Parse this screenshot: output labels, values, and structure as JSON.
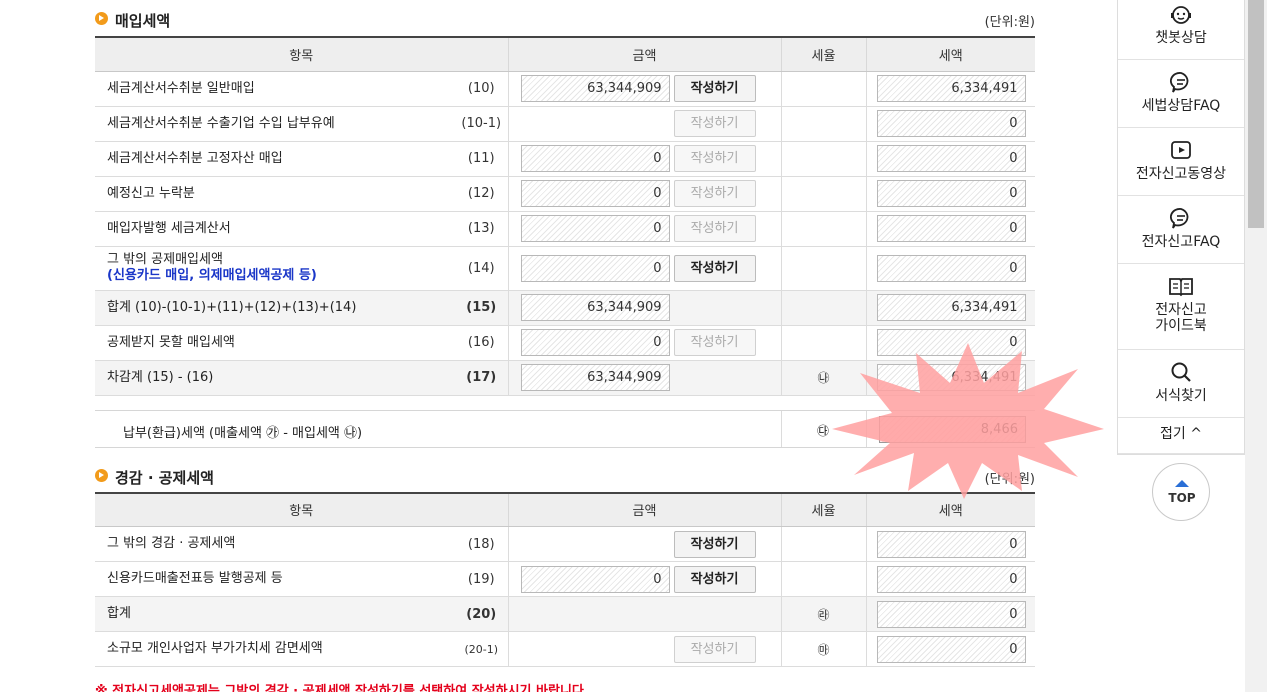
{
  "purchase": {
    "title": "매입세액",
    "unit": "(단위:원)",
    "headers": [
      "항목",
      "금액",
      "세율",
      "세액"
    ],
    "rows": [
      {
        "label": "세금계산서수취분 일반매입",
        "code": "(10)",
        "amount": "63,344,909",
        "button": "작성하기",
        "rate": "",
        "tax": "6,334,491"
      },
      {
        "label": "세금계산서수취분 수출기업 수입 납부유예",
        "code": "(10-1)",
        "amount": "",
        "button": "작성하기",
        "rate": "",
        "tax": "0"
      },
      {
        "label": "세금계산서수취분 고정자산 매입",
        "code": "(11)",
        "amount": "0",
        "button": "작성하기",
        "rate": "",
        "tax": "0"
      },
      {
        "label": "예정신고 누락분",
        "code": "(12)",
        "amount": "0",
        "button": "작성하기",
        "rate": "",
        "tax": "0"
      },
      {
        "label": "매입자발행 세금계산서",
        "code": "(13)",
        "amount": "0",
        "button": "작성하기",
        "rate": "",
        "tax": "0"
      },
      {
        "label": "그 밖의 공제매입세액",
        "sublabel": "(신용카드 매입, 의제매입세액공제 등)",
        "code": "(14)",
        "amount": "0",
        "button": "작성하기",
        "rate": "",
        "tax": "0"
      },
      {
        "label": "합계 (10)-(10-1)+(11)+(12)+(13)+(14)",
        "code": "(15)",
        "amount": "63,344,909",
        "button": "",
        "rate": "",
        "tax": "6,334,491"
      },
      {
        "label": "공제받지 못할 매입세액",
        "code": "(16)",
        "amount": "0",
        "button": "작성하기",
        "rate": "",
        "tax": "0"
      },
      {
        "label": "차감계 (15) - (16)",
        "code": "(17)",
        "amount": "63,344,909",
        "button": "",
        "rate": "㉯",
        "tax": "6,334,491"
      }
    ]
  },
  "payment": {
    "label": "납부(환급)세액 (매출세액 ㉮ - 매입세액 ㉯)",
    "mark": "㉰",
    "value": "8,466"
  },
  "reduction": {
    "title": "경감 · 공제세액",
    "unit": "(단위:원)",
    "headers": [
      "항목",
      "금액",
      "세율",
      "세액"
    ],
    "rows": [
      {
        "label": "그 밖의 경감 · 공제세액",
        "code": "(18)",
        "amount": "",
        "button": "작성하기",
        "rate": "",
        "tax": "0"
      },
      {
        "label": "신용카드매출전표등 발행공제 등",
        "code": "(19)",
        "amount": "0",
        "button": "작성하기",
        "rate": "",
        "tax": "0"
      },
      {
        "label": "합계",
        "code": "(20)",
        "amount": "",
        "button": "",
        "rate": "㉱",
        "tax": "0"
      },
      {
        "label": "소규모 개인사업자 부가가치세 감면세액",
        "code": "(20-1)",
        "amount": "",
        "button": "작성하기",
        "rate": "㉲",
        "tax": "0"
      }
    ]
  },
  "warning": "※ 전자신고세액공제는 그밖의 경감 · 공제세액 작성하기를 선택하여 작성하시기 바랍니다.",
  "sidebar": {
    "items": [
      "챗봇상담",
      "세법상담FAQ",
      "전자신고동영상",
      "전자신고FAQ",
      "전자신고\n가이드북",
      "서식찾기"
    ],
    "guide_line1": "전자신고",
    "guide_line2": "가이드북",
    "collapse": "접기 ^",
    "top": "TOP"
  },
  "colors": {
    "accent": "#f29b1b",
    "warning": "#e4001b",
    "blue_note": "#1a36c8",
    "highlight": "#ffa0a0"
  }
}
